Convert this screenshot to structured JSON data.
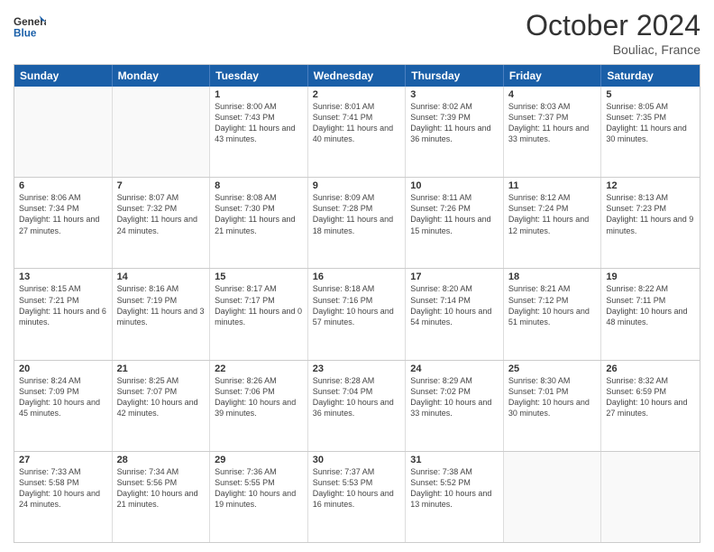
{
  "header": {
    "logo_general": "General",
    "logo_blue": "Blue",
    "month_title": "October 2024",
    "location": "Bouliac, France"
  },
  "days_of_week": [
    "Sunday",
    "Monday",
    "Tuesday",
    "Wednesday",
    "Thursday",
    "Friday",
    "Saturday"
  ],
  "weeks": [
    [
      {
        "day": "",
        "sunrise": "",
        "sunset": "",
        "daylight": "",
        "empty": true
      },
      {
        "day": "",
        "sunrise": "",
        "sunset": "",
        "daylight": "",
        "empty": true
      },
      {
        "day": "1",
        "sunrise": "Sunrise: 8:00 AM",
        "sunset": "Sunset: 7:43 PM",
        "daylight": "Daylight: 11 hours and 43 minutes."
      },
      {
        "day": "2",
        "sunrise": "Sunrise: 8:01 AM",
        "sunset": "Sunset: 7:41 PM",
        "daylight": "Daylight: 11 hours and 40 minutes."
      },
      {
        "day": "3",
        "sunrise": "Sunrise: 8:02 AM",
        "sunset": "Sunset: 7:39 PM",
        "daylight": "Daylight: 11 hours and 36 minutes."
      },
      {
        "day": "4",
        "sunrise": "Sunrise: 8:03 AM",
        "sunset": "Sunset: 7:37 PM",
        "daylight": "Daylight: 11 hours and 33 minutes."
      },
      {
        "day": "5",
        "sunrise": "Sunrise: 8:05 AM",
        "sunset": "Sunset: 7:35 PM",
        "daylight": "Daylight: 11 hours and 30 minutes."
      }
    ],
    [
      {
        "day": "6",
        "sunrise": "Sunrise: 8:06 AM",
        "sunset": "Sunset: 7:34 PM",
        "daylight": "Daylight: 11 hours and 27 minutes."
      },
      {
        "day": "7",
        "sunrise": "Sunrise: 8:07 AM",
        "sunset": "Sunset: 7:32 PM",
        "daylight": "Daylight: 11 hours and 24 minutes."
      },
      {
        "day": "8",
        "sunrise": "Sunrise: 8:08 AM",
        "sunset": "Sunset: 7:30 PM",
        "daylight": "Daylight: 11 hours and 21 minutes."
      },
      {
        "day": "9",
        "sunrise": "Sunrise: 8:09 AM",
        "sunset": "Sunset: 7:28 PM",
        "daylight": "Daylight: 11 hours and 18 minutes."
      },
      {
        "day": "10",
        "sunrise": "Sunrise: 8:11 AM",
        "sunset": "Sunset: 7:26 PM",
        "daylight": "Daylight: 11 hours and 15 minutes."
      },
      {
        "day": "11",
        "sunrise": "Sunrise: 8:12 AM",
        "sunset": "Sunset: 7:24 PM",
        "daylight": "Daylight: 11 hours and 12 minutes."
      },
      {
        "day": "12",
        "sunrise": "Sunrise: 8:13 AM",
        "sunset": "Sunset: 7:23 PM",
        "daylight": "Daylight: 11 hours and 9 minutes."
      }
    ],
    [
      {
        "day": "13",
        "sunrise": "Sunrise: 8:15 AM",
        "sunset": "Sunset: 7:21 PM",
        "daylight": "Daylight: 11 hours and 6 minutes."
      },
      {
        "day": "14",
        "sunrise": "Sunrise: 8:16 AM",
        "sunset": "Sunset: 7:19 PM",
        "daylight": "Daylight: 11 hours and 3 minutes."
      },
      {
        "day": "15",
        "sunrise": "Sunrise: 8:17 AM",
        "sunset": "Sunset: 7:17 PM",
        "daylight": "Daylight: 11 hours and 0 minutes."
      },
      {
        "day": "16",
        "sunrise": "Sunrise: 8:18 AM",
        "sunset": "Sunset: 7:16 PM",
        "daylight": "Daylight: 10 hours and 57 minutes."
      },
      {
        "day": "17",
        "sunrise": "Sunrise: 8:20 AM",
        "sunset": "Sunset: 7:14 PM",
        "daylight": "Daylight: 10 hours and 54 minutes."
      },
      {
        "day": "18",
        "sunrise": "Sunrise: 8:21 AM",
        "sunset": "Sunset: 7:12 PM",
        "daylight": "Daylight: 10 hours and 51 minutes."
      },
      {
        "day": "19",
        "sunrise": "Sunrise: 8:22 AM",
        "sunset": "Sunset: 7:11 PM",
        "daylight": "Daylight: 10 hours and 48 minutes."
      }
    ],
    [
      {
        "day": "20",
        "sunrise": "Sunrise: 8:24 AM",
        "sunset": "Sunset: 7:09 PM",
        "daylight": "Daylight: 10 hours and 45 minutes."
      },
      {
        "day": "21",
        "sunrise": "Sunrise: 8:25 AM",
        "sunset": "Sunset: 7:07 PM",
        "daylight": "Daylight: 10 hours and 42 minutes."
      },
      {
        "day": "22",
        "sunrise": "Sunrise: 8:26 AM",
        "sunset": "Sunset: 7:06 PM",
        "daylight": "Daylight: 10 hours and 39 minutes."
      },
      {
        "day": "23",
        "sunrise": "Sunrise: 8:28 AM",
        "sunset": "Sunset: 7:04 PM",
        "daylight": "Daylight: 10 hours and 36 minutes."
      },
      {
        "day": "24",
        "sunrise": "Sunrise: 8:29 AM",
        "sunset": "Sunset: 7:02 PM",
        "daylight": "Daylight: 10 hours and 33 minutes."
      },
      {
        "day": "25",
        "sunrise": "Sunrise: 8:30 AM",
        "sunset": "Sunset: 7:01 PM",
        "daylight": "Daylight: 10 hours and 30 minutes."
      },
      {
        "day": "26",
        "sunrise": "Sunrise: 8:32 AM",
        "sunset": "Sunset: 6:59 PM",
        "daylight": "Daylight: 10 hours and 27 minutes."
      }
    ],
    [
      {
        "day": "27",
        "sunrise": "Sunrise: 7:33 AM",
        "sunset": "Sunset: 5:58 PM",
        "daylight": "Daylight: 10 hours and 24 minutes."
      },
      {
        "day": "28",
        "sunrise": "Sunrise: 7:34 AM",
        "sunset": "Sunset: 5:56 PM",
        "daylight": "Daylight: 10 hours and 21 minutes."
      },
      {
        "day": "29",
        "sunrise": "Sunrise: 7:36 AM",
        "sunset": "Sunset: 5:55 PM",
        "daylight": "Daylight: 10 hours and 19 minutes."
      },
      {
        "day": "30",
        "sunrise": "Sunrise: 7:37 AM",
        "sunset": "Sunset: 5:53 PM",
        "daylight": "Daylight: 10 hours and 16 minutes."
      },
      {
        "day": "31",
        "sunrise": "Sunrise: 7:38 AM",
        "sunset": "Sunset: 5:52 PM",
        "daylight": "Daylight: 10 hours and 13 minutes."
      },
      {
        "day": "",
        "sunrise": "",
        "sunset": "",
        "daylight": "",
        "empty": true
      },
      {
        "day": "",
        "sunrise": "",
        "sunset": "",
        "daylight": "",
        "empty": true
      }
    ]
  ]
}
